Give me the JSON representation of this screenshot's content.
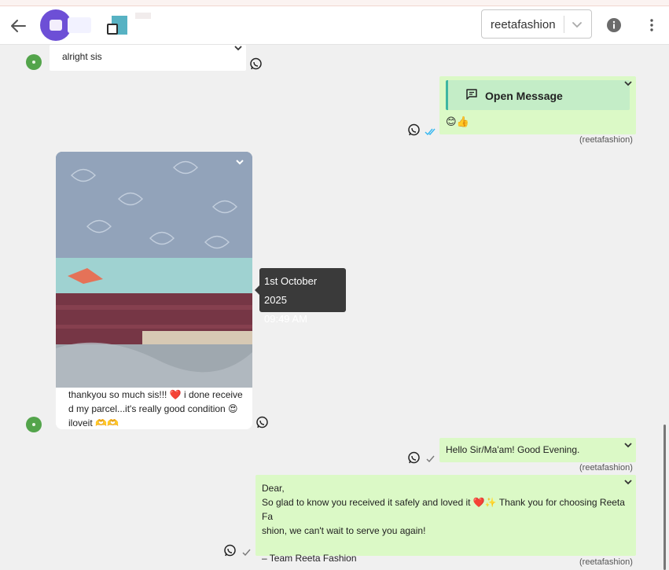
{
  "header": {
    "account_label": "reetafashion"
  },
  "messages": [
    {
      "id": "m1",
      "direction": "incoming",
      "text": "alright sis"
    },
    {
      "id": "m2",
      "direction": "outgoing",
      "button_label": "Open Message",
      "emojis": "😊👍",
      "sender": "(reetafashion)"
    },
    {
      "id": "m3",
      "direction": "incoming",
      "lines": [
        "thankyou so much sis!!! ❤️ i done receive",
        "d my parcel...it's really good condition 😍",
        "iloveit 🫶🫶"
      ]
    },
    {
      "id": "m4",
      "direction": "outgoing",
      "text": "Hello Sir/Ma'am! Good Evening.",
      "sender": "(reetafashion)"
    },
    {
      "id": "m5",
      "direction": "outgoing",
      "lines": [
        "Dear,",
        "So glad to know you received it safely and loved it ❤️✨ Thank you for choosing Reeta Fa",
        "shion, we can't wait to serve you again!",
        "",
        "– Team Reeta Fashion"
      ],
      "sender": "(reetafashion)"
    }
  ],
  "tooltip": {
    "date": "1st October 2025",
    "time": "09:49 AM"
  },
  "icons": [
    "back-arrow-icon",
    "info-icon",
    "more-vert-icon",
    "whatsapp-icon",
    "chevron-down-icon",
    "double-check-icon",
    "single-check-icon",
    "message-icon"
  ]
}
